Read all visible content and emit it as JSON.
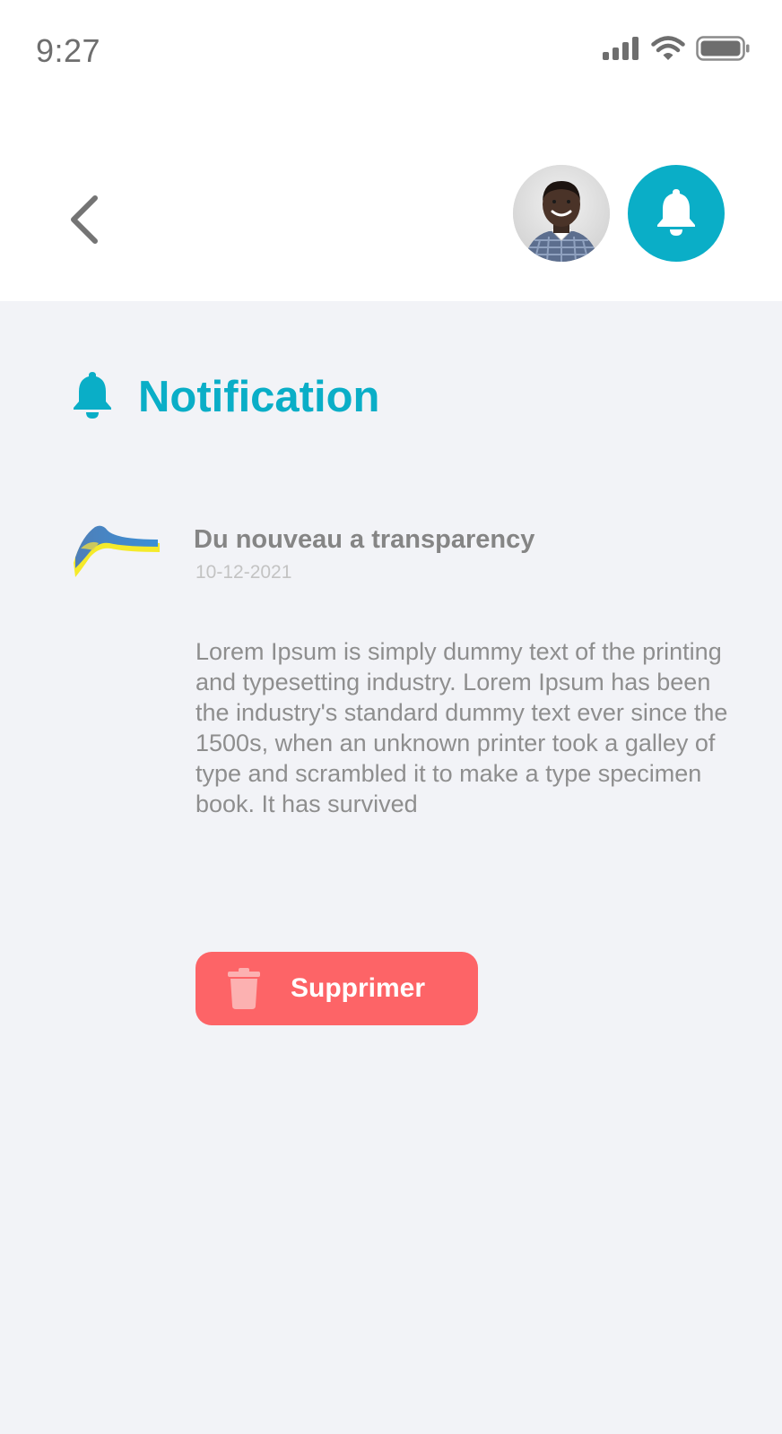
{
  "status_bar": {
    "time": "9:27",
    "icons": [
      "cellular-signal-icon",
      "wifi-icon",
      "battery-icon"
    ]
  },
  "header": {
    "back_icon": "chevron-left-icon",
    "avatar": "user-avatar",
    "bell_icon": "bell-icon"
  },
  "section": {
    "icon": "bell-icon",
    "title": "Notification"
  },
  "notification": {
    "logo": "transparency-logo",
    "title": "Du nouveau a transparency",
    "date": "10-12-2021",
    "body": "Lorem Ipsum is simply dummy text of the printing and typesetting industry. Lorem Ipsum has been the industry's standard dummy text ever since the 1500s, when an unknown printer took a galley of type and scrambled it to make a type specimen book. It has survived",
    "delete_label": "Supprimer",
    "delete_icon": "trash-icon"
  },
  "colors": {
    "accent": "#0aaec7",
    "danger": "#fd6467",
    "background": "#f2f3f7",
    "text_muted": "#8e8e8e"
  }
}
